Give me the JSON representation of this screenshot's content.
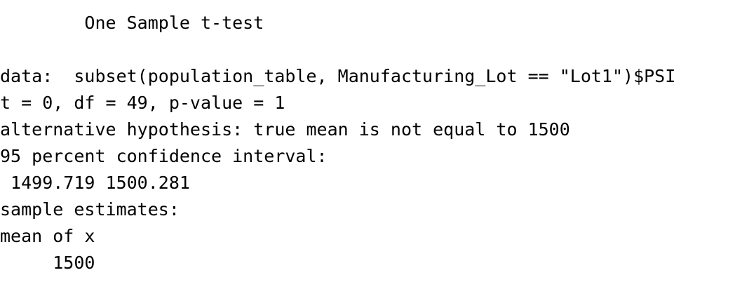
{
  "console_output": {
    "title": "        One Sample t-test",
    "blank": "",
    "data_line": "data:  subset(population_table, Manufacturing_Lot == \"Lot1\")$PSI",
    "stats_line": "t = 0, df = 49, p-value = 1",
    "alternative_line": "alternative hypothesis: true mean is not equal to 1500",
    "ci_header": "95 percent confidence interval:",
    "ci_values": " 1499.719 1500.281",
    "estimates_header": "sample estimates:",
    "estimate_label": "mean of x",
    "estimate_value": "     1500"
  }
}
